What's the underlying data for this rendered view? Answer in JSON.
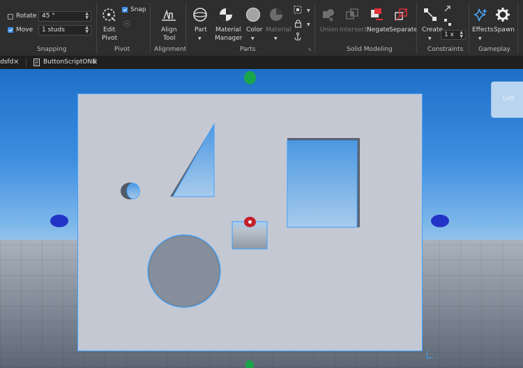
{
  "ribbon": {
    "snapping": {
      "rotate_label": "Rotate",
      "rotate_checked": false,
      "rotate_value": "45 °",
      "move_label": "Move",
      "move_checked": true,
      "move_value": "1 studs",
      "group_label": "Snapping"
    },
    "pivot": {
      "edit_pivot_label_1": "Edit",
      "edit_pivot_label_2": "Pivot",
      "snap_label": "Snap",
      "snap_checked": true,
      "group_label": "Pivot"
    },
    "alignment": {
      "align_label_1": "Align",
      "align_label_2": "Tool",
      "group_label": "Alignment"
    },
    "parts": {
      "part_label": "Part",
      "material_manager_label_1": "Material",
      "material_manager_label_2": "Manager",
      "color_label": "Color",
      "material_label": "Material",
      "group_label": "Parts"
    },
    "solid_modeling": {
      "union_label": "Union",
      "intersect_label": "Intersect",
      "negate_label": "Negate",
      "separate_label": "Separate",
      "group_label": "Solid Modeling"
    },
    "constraints": {
      "create_label": "Create",
      "scale_value": "1 x",
      "group_label": "Constraints"
    },
    "gameplay": {
      "effects_label": "Effects",
      "spawn_label": "Spawn",
      "group_label": "Gameplay"
    }
  },
  "tabs": [
    {
      "label": "dsfd"
    },
    {
      "label": "ButtonScriptONE"
    }
  ],
  "viewport": {
    "viewcube_label": "Left"
  },
  "colors": {
    "ribbon_bg": "#2e2e2e",
    "accent_blue": "#3d8ee8",
    "negate_red": "#e0313a",
    "selection_outline": "#3ea0ff",
    "handle_green": "#1aa54a",
    "handle_blue": "#2233c8",
    "handle_red": "#c4202a"
  }
}
